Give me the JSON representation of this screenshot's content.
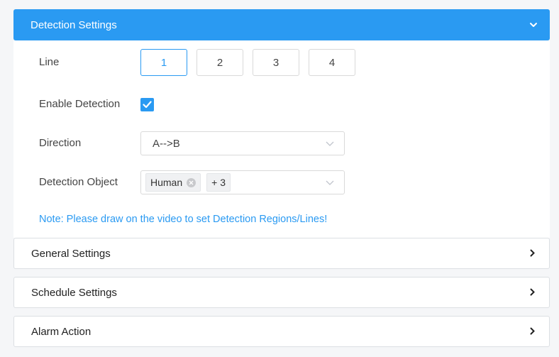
{
  "detection": {
    "title": "Detection Settings",
    "line": {
      "label": "Line",
      "options": [
        "1",
        "2",
        "3",
        "4"
      ],
      "selected": "1"
    },
    "enable": {
      "label": "Enable Detection",
      "checked": true
    },
    "direction": {
      "label": "Direction",
      "value": "A-->B"
    },
    "object": {
      "label": "Detection Object",
      "tag": "Human",
      "more": "+ 3"
    },
    "note": "Note: Please draw on the video to set Detection Regions/Lines!"
  },
  "sections": [
    {
      "title": "General Settings"
    },
    {
      "title": "Schedule Settings"
    },
    {
      "title": "Alarm Action"
    }
  ],
  "colors": {
    "accent": "#2a9af2",
    "border": "#d9d9d9",
    "background": "#f5f6f8"
  },
  "icons": {
    "header": "chevron-down-icon",
    "section": "chevron-right-icon",
    "checkbox": "checkmark-icon",
    "select": "chevron-down-icon",
    "tag": "close-circle-icon"
  }
}
